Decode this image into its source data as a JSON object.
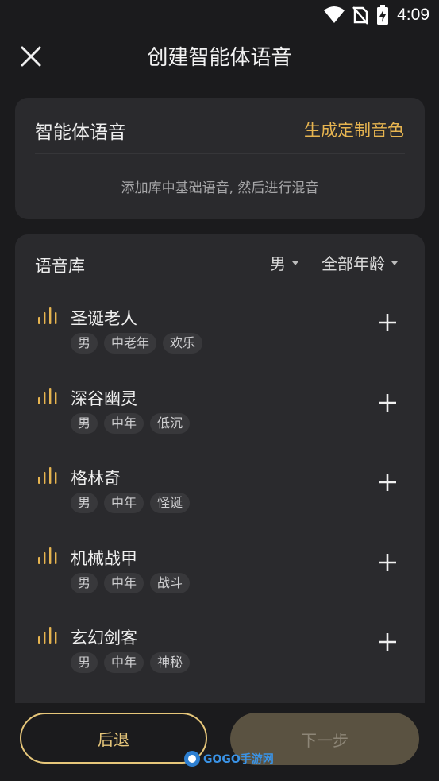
{
  "status_bar": {
    "time": "4:09"
  },
  "header": {
    "title": "创建智能体语音"
  },
  "agent_voice_card": {
    "label": "智能体语音",
    "action": "生成定制音色",
    "hint": "添加库中基础语音, 然后进行混音"
  },
  "library": {
    "title": "语音库",
    "filter_gender": "男",
    "filter_age": "全部年龄",
    "voices": [
      {
        "name": "圣诞老人",
        "tags": [
          "男",
          "中老年",
          "欢乐"
        ]
      },
      {
        "name": "深谷幽灵",
        "tags": [
          "男",
          "中年",
          "低沉"
        ]
      },
      {
        "name": "格林奇",
        "tags": [
          "男",
          "中年",
          "怪诞"
        ]
      },
      {
        "name": "机械战甲",
        "tags": [
          "男",
          "中年",
          "战斗"
        ]
      },
      {
        "name": "玄幻剑客",
        "tags": [
          "男",
          "中年",
          "神秘"
        ]
      }
    ]
  },
  "footer": {
    "back_label": "后退",
    "next_label": "下一步",
    "watermark": "GOGO手游网"
  },
  "colors": {
    "accent": "#e6b450",
    "card": "#2a2a2d",
    "background": "#1b1b1d"
  }
}
